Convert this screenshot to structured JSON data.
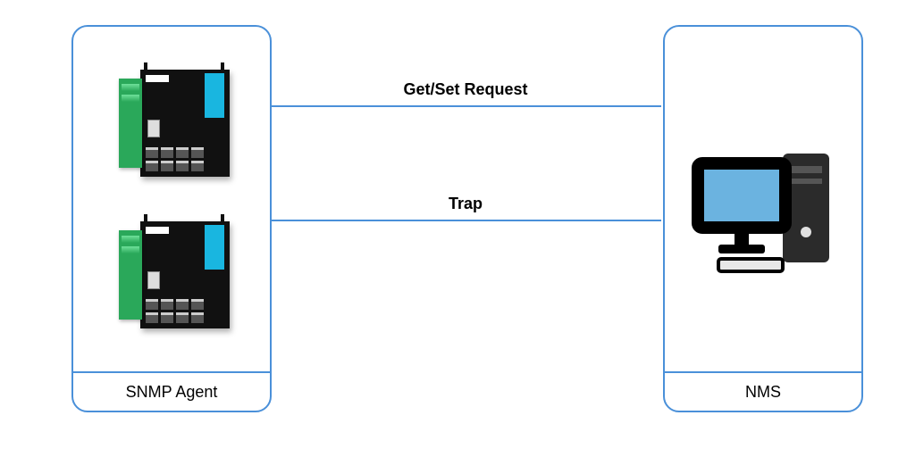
{
  "diagram": {
    "agent": {
      "label": "SNMP Agent"
    },
    "nms": {
      "label": "NMS"
    },
    "links": {
      "request": "Get/Set Request",
      "trap": "Trap"
    }
  }
}
